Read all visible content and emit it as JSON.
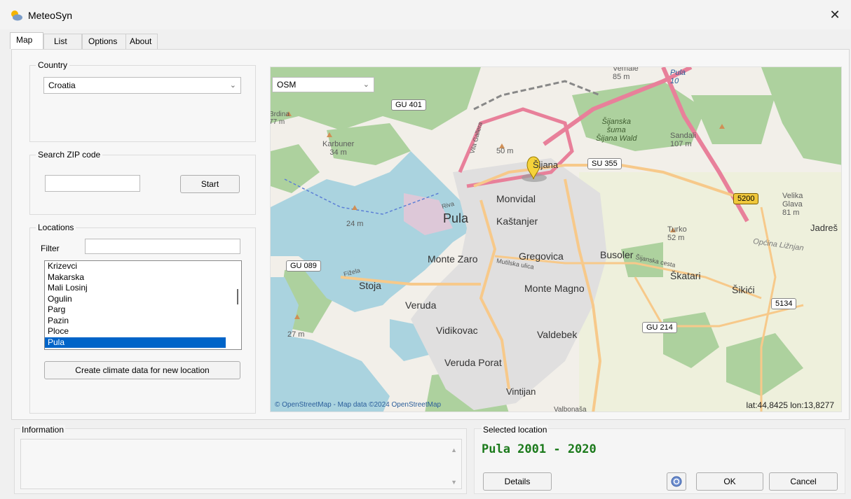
{
  "window": {
    "title": "MeteoSyn",
    "close_glyph": "✕"
  },
  "tabs": [
    {
      "label": "Map"
    },
    {
      "label": "List"
    },
    {
      "label": "Options"
    },
    {
      "label": "About"
    }
  ],
  "country": {
    "legend": "Country",
    "value": "Croatia"
  },
  "zip": {
    "legend": "Search ZIP code",
    "value": "",
    "start_label": "Start"
  },
  "locations": {
    "legend": "Locations",
    "filter_label": "Filter",
    "filter_value": "",
    "items": [
      "Krizevci",
      "Makarska",
      "Mali Losinj",
      "Ogulin",
      "Parg",
      "Pazin",
      "Ploce",
      "Pula"
    ],
    "selected": "Pula",
    "create_label": "Create climate data for new location"
  },
  "map": {
    "layer": "OSM",
    "credit": "© OpenStreetMap - Map data ©2024 OpenStreetMap",
    "coords": "lat:44,8425  lon:13,8277",
    "labels": {
      "pula": "Pula",
      "monvidal": "Monvidal",
      "kastanjer": "Kaštanjer",
      "monte_zaro": "Monte Zaro",
      "gregovica": "Gregovica",
      "busoler": "Busoler",
      "stoja": "Stoja",
      "veruda": "Veruda",
      "monte_magno": "Monte Magno",
      "vidikovac": "Vidikovac",
      "valdebek": "Valdebek",
      "veruda_porat": "Veruda Porat",
      "vintijan": "Vintijan",
      "skatari": "Škatari",
      "sikici": "Šikići",
      "jadres": "Jadreš",
      "brdina": "Brdina",
      "brdina_elev": "77 m",
      "karbuner": "Karbuner",
      "karbuner_elev": "34 m",
      "elev_24": "24 m",
      "elev_27": "27 m",
      "elev_50": "50 m",
      "sijanska": "Šijanska",
      "suma": "šuma",
      "sijana_wald": "Šijana Wald",
      "sandali": "Sandali",
      "sandali_elev": "107 m",
      "velika": "Velika",
      "glava": "Glava",
      "velika_elev": "81 m",
      "turko": "Turko",
      "turko_elev": "52 m",
      "opcina": "Općina Ližnjan",
      "vemale": "Vemale",
      "vemale_elev": "85 m",
      "pula_top": "Pula",
      "road_10": "10",
      "sijana": "Šijana",
      "riva": "Riva",
      "fizela": "Fižela",
      "mutilska": "Mutilska ulica",
      "sijanska_cesta": "Šijanska cesta",
      "vila_gallera": "Vila Gallera",
      "valbonasa": "Valbonaša"
    },
    "shields": {
      "gu401": "GU 401",
      "su355": "SU 355",
      "gu089": "GU 089",
      "gu214": "GU 214",
      "r5134": "5134",
      "r5200": "5200"
    }
  },
  "information": {
    "legend": "Information",
    "scroll_up": "▲",
    "scroll_down": "▼"
  },
  "selected": {
    "legend": "Selected location",
    "title": "Pula 2001 - 2020",
    "details_label": "Details",
    "ok_label": "OK",
    "cancel_label": "Cancel"
  },
  "colors": {
    "accent_green": "#1b7a1b",
    "selection_blue": "#0064c8",
    "water": "#a9d3e6",
    "forest": "#abd49b",
    "urban": "#e1dcd3",
    "road_major": "#e7839a",
    "road_yellow": "#f7d79a"
  },
  "icons": [
    "app-sun-cloud-icon",
    "close-icon",
    "chevron-down-icon",
    "map-pin-icon",
    "help-icon",
    "scroll-up-arrow-icon",
    "scroll-down-arrow-icon"
  ]
}
